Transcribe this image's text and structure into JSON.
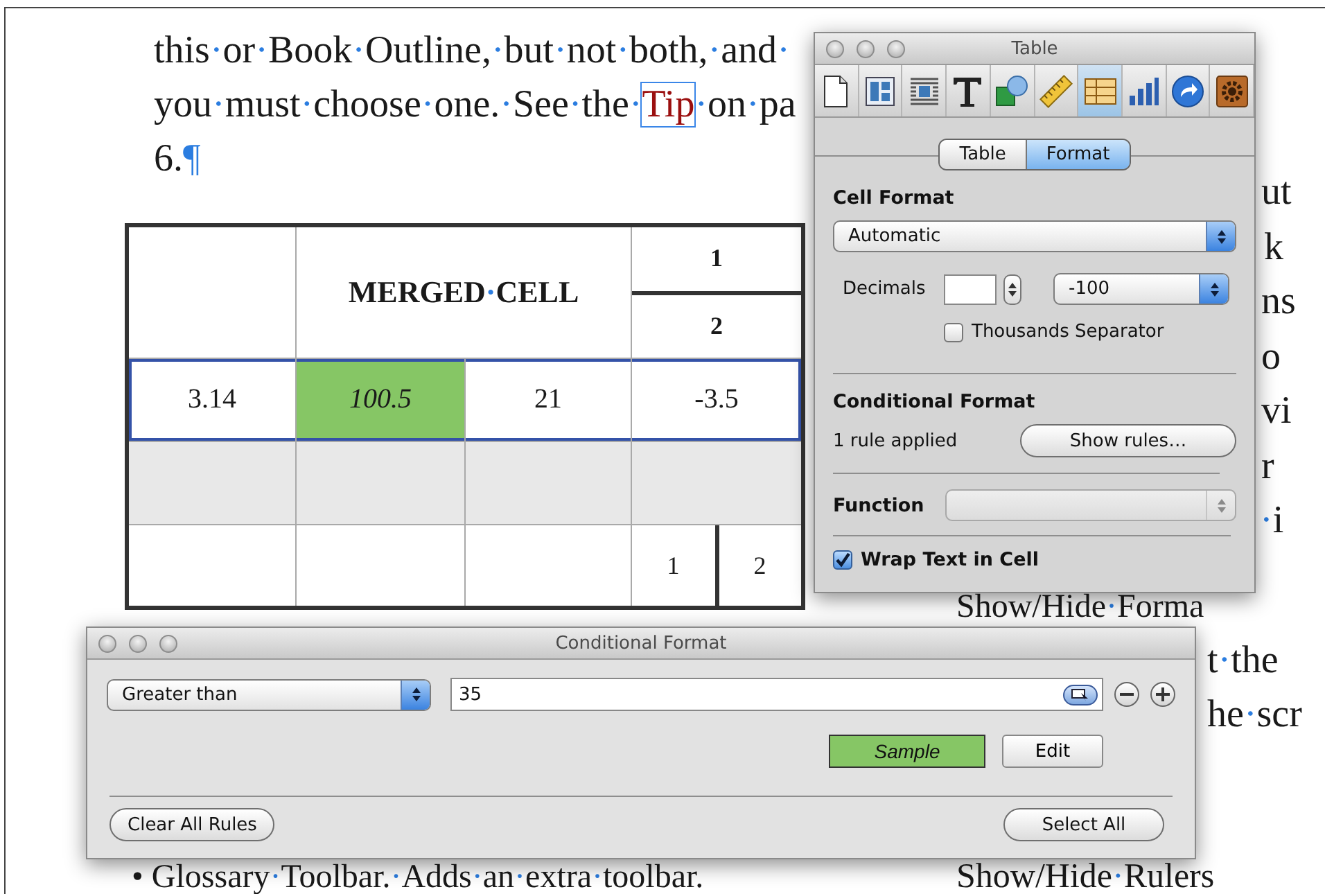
{
  "document": {
    "lines": [
      {
        "segments": [
          {
            "kind": "plain",
            "text": "this·or·Book·Outline,·but·not·both,·and·"
          }
        ]
      },
      {
        "segments": [
          {
            "kind": "plain",
            "text": "you·must·choose·one.·See·the·"
          },
          {
            "kind": "link",
            "text": "Tip"
          },
          {
            "kind": "plain",
            "text": "·on·pa"
          }
        ]
      },
      {
        "segments": [
          {
            "kind": "plain",
            "text": "6.¶"
          }
        ]
      }
    ],
    "table": {
      "rows": [
        {
          "header": true,
          "selected": false,
          "shaded": false,
          "cells": [
            {
              "kind": "blank",
              "highlighted": false
            },
            {
              "kind": "merged",
              "text": "MERGED·CELL",
              "colspan": 2,
              "highlighted": false
            },
            {
              "kind": "stacked",
              "parts": [
                "1",
                "2"
              ],
              "highlighted": false
            }
          ]
        },
        {
          "header": false,
          "selected": true,
          "shaded": false,
          "cells": [
            {
              "kind": "plain",
              "text": "3.14",
              "highlighted": false
            },
            {
              "kind": "plain",
              "text": "100.5",
              "highlighted": true
            },
            {
              "kind": "plain",
              "text": "21",
              "highlighted": false
            },
            {
              "kind": "plain",
              "text": "-3.5",
              "highlighted": false
            }
          ]
        },
        {
          "header": false,
          "selected": false,
          "shaded": true,
          "cells": [
            {
              "kind": "blank",
              "highlighted": false
            },
            {
              "kind": "blank",
              "highlighted": false
            },
            {
              "kind": "blank",
              "highlighted": false
            },
            {
              "kind": "blank",
              "highlighted": false
            }
          ]
        },
        {
          "header": false,
          "selected": false,
          "shaded": false,
          "cells": [
            {
              "kind": "blank",
              "highlighted": false
            },
            {
              "kind": "blank",
              "highlighted": false
            },
            {
              "kind": "blank",
              "highlighted": false
            },
            {
              "kind": "side-by-side",
              "parts": [
                "1",
                "2"
              ],
              "highlighted": false
            }
          ]
        }
      ]
    },
    "bullet": {
      "marker": "•",
      "text": "Glossary·Toolbar.·Adds·an·extra·toolbar."
    },
    "right_column": [
      "ut",
      "k",
      "ns",
      "o",
      "vi",
      "r",
      "·i",
      "Show/Hide·Forma",
      "t·the",
      "he·scr",
      "Show/Hide·Rulers"
    ]
  },
  "inspector": {
    "title": "Table",
    "toolbar": [
      {
        "kind": "document",
        "selected": false
      },
      {
        "kind": "layout",
        "selected": false
      },
      {
        "kind": "wrap",
        "selected": false
      },
      {
        "kind": "text",
        "selected": false
      },
      {
        "kind": "shapes",
        "selected": false
      },
      {
        "kind": "ruler",
        "selected": false
      },
      {
        "kind": "table",
        "selected": true
      },
      {
        "kind": "chart",
        "selected": false
      },
      {
        "kind": "link",
        "selected": false
      },
      {
        "kind": "gear",
        "selected": false
      }
    ],
    "tabs": [
      {
        "label": "Table",
        "selected": false
      },
      {
        "label": "Format",
        "selected": true
      }
    ],
    "cell_format": {
      "heading": "Cell Format",
      "format": "Automatic",
      "decimals_label": "Decimals",
      "negative_format": "-100",
      "thousands_separator": {
        "label": "Thousands Separator",
        "checked": false
      }
    },
    "conditional_format": {
      "heading": "Conditional Format",
      "status": "1 rule applied",
      "button": "Show rules…"
    },
    "function": {
      "label": "Function",
      "disabled": true
    },
    "wrap_text": {
      "label": "Wrap Text in Cell",
      "checked": true
    }
  },
  "conditional_window": {
    "title": "Conditional Format",
    "condition": "Greater than",
    "value": "35",
    "sample": "Sample",
    "edit_button": "Edit",
    "clear_button": "Clear All Rules",
    "select_button": "Select All"
  }
}
